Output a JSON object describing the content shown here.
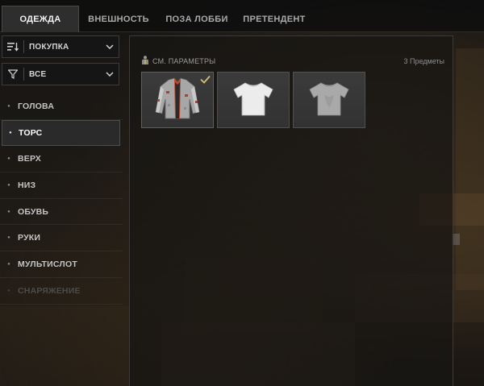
{
  "tabs": [
    {
      "label": "ОДЕЖДА",
      "active": true
    },
    {
      "label": "ВНЕШНОСТЬ",
      "active": false
    },
    {
      "label": "ПОЗА ЛОББИ",
      "active": false
    },
    {
      "label": "ПРЕТЕНДЕНТ",
      "active": false
    }
  ],
  "filters": {
    "sort": {
      "label": "ПОКУПКА",
      "icon": "sort-icon"
    },
    "filter": {
      "label": "ВСЕ",
      "icon": "filter-funnel-icon"
    }
  },
  "categories": [
    {
      "label": "ГОЛОВА",
      "active": false,
      "disabled": false
    },
    {
      "label": "ТОРС",
      "active": true,
      "disabled": false
    },
    {
      "label": "ВЕРХ",
      "active": false,
      "disabled": false
    },
    {
      "label": "НИЗ",
      "active": false,
      "disabled": false
    },
    {
      "label": "ОБУВЬ",
      "active": false,
      "disabled": false
    },
    {
      "label": "РУКИ",
      "active": false,
      "disabled": false
    },
    {
      "label": "МУЛЬТИСЛОТ",
      "active": false,
      "disabled": false
    },
    {
      "label": "СНАРЯЖЕНИЕ",
      "active": false,
      "disabled": true
    }
  ],
  "panel": {
    "compare_label": "СМ. ПАРАМЕТРЫ",
    "compare_icon": "mannequin-icon",
    "item_count": "3 Предметы"
  },
  "items": [
    {
      "name": "patterned-jacket",
      "icon": "jacket-icon",
      "equipped": true
    },
    {
      "name": "white-tshirt",
      "icon": "tshirt-icon",
      "equipped": false
    },
    {
      "name": "grey-tshirt",
      "icon": "tshirt-icon",
      "equipped": false
    }
  ],
  "colors": {
    "accent_check": "#d6c26a",
    "panel_bg": "#1a1816",
    "card_bg": "#363636",
    "active_tab_bg": "#2e2e2e"
  }
}
